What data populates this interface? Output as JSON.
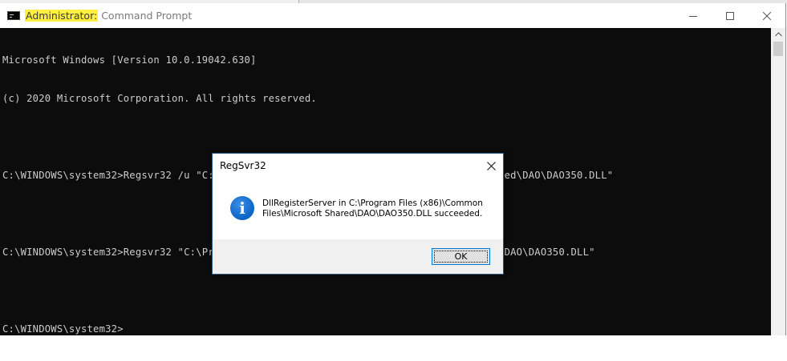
{
  "window": {
    "title_highlight": "Administrator:",
    "title_rest": "Command Prompt"
  },
  "console": {
    "lines": [
      "Microsoft Windows [Version 10.0.19042.630]",
      "(c) 2020 Microsoft Corporation. All rights reserved.",
      "",
      "C:\\WINDOWS\\system32>Regsvr32 /u \"C:\\Program Files (x86)\\Common Files\\Microsoft Shared\\DAO\\DAO350.DLL\"",
      "",
      "C:\\WINDOWS\\system32>Regsvr32 \"C:\\Program Files (x86)\\Common Files\\Microsoft Shared\\DAO\\DAO350.DLL\"",
      "",
      "C:\\WINDOWS\\system32>"
    ]
  },
  "dialog": {
    "title": "RegSvr32",
    "icon": "info-icon",
    "icon_glyph": "i",
    "message_line1": "DllRegisterServer in C:\\Program Files (x86)\\Common",
    "message_line2": "Files\\Microsoft Shared\\DAO\\DAO350.DLL succeeded.",
    "ok_label": "OK"
  },
  "colors": {
    "console_bg": "#0c0c0c",
    "console_text": "#cccccc",
    "title_highlight": "#ffef3f",
    "accent": "#0078d7"
  }
}
